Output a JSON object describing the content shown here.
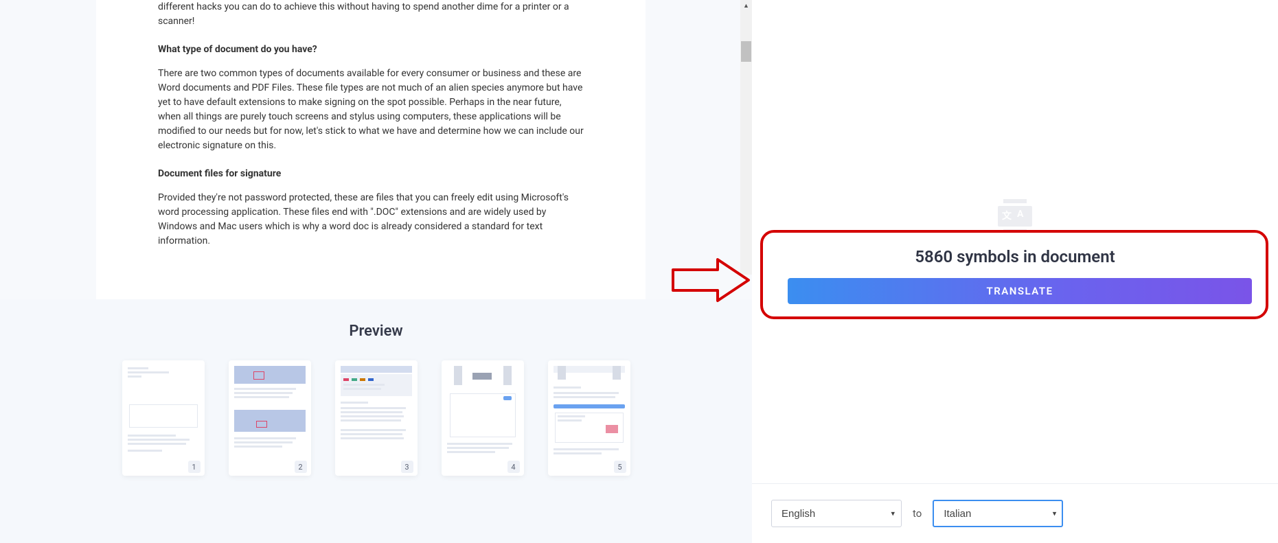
{
  "document": {
    "para_intro_tail": "different hacks you can do to achieve this without having to spend another dime for a printer or a scanner!",
    "heading1": "What type of document do you have?",
    "para1": "There are two common types of documents available for every consumer or business and these are Word documents and PDF Files. These file types are not much of an alien species anymore but have yet to have default extensions to make signing on the spot possible. Perhaps in the near future, when all things are purely touch screens and stylus using computers, these applications will be modified to our needs but for now, let's stick to what we have and determine how we can include our electronic signature on this.",
    "heading2": "Document files for signature",
    "para2": "Provided they're not password protected, these are files that you can freely edit using Microsoft's word processing application. These files end with \".DOC\" extensions and are widely used by Windows and Mac users which is why a word doc is already considered a standard for text information."
  },
  "preview": {
    "title": "Preview",
    "pages": [
      {
        "num": "1"
      },
      {
        "num": "2"
      },
      {
        "num": "3"
      },
      {
        "num": "4"
      },
      {
        "num": "5"
      }
    ]
  },
  "sidebar": {
    "symbols_text": "5860 symbols in document",
    "translate_label": "TRANSLATE",
    "to_label": "to",
    "lang_from": "English",
    "lang_to": "Italian"
  }
}
